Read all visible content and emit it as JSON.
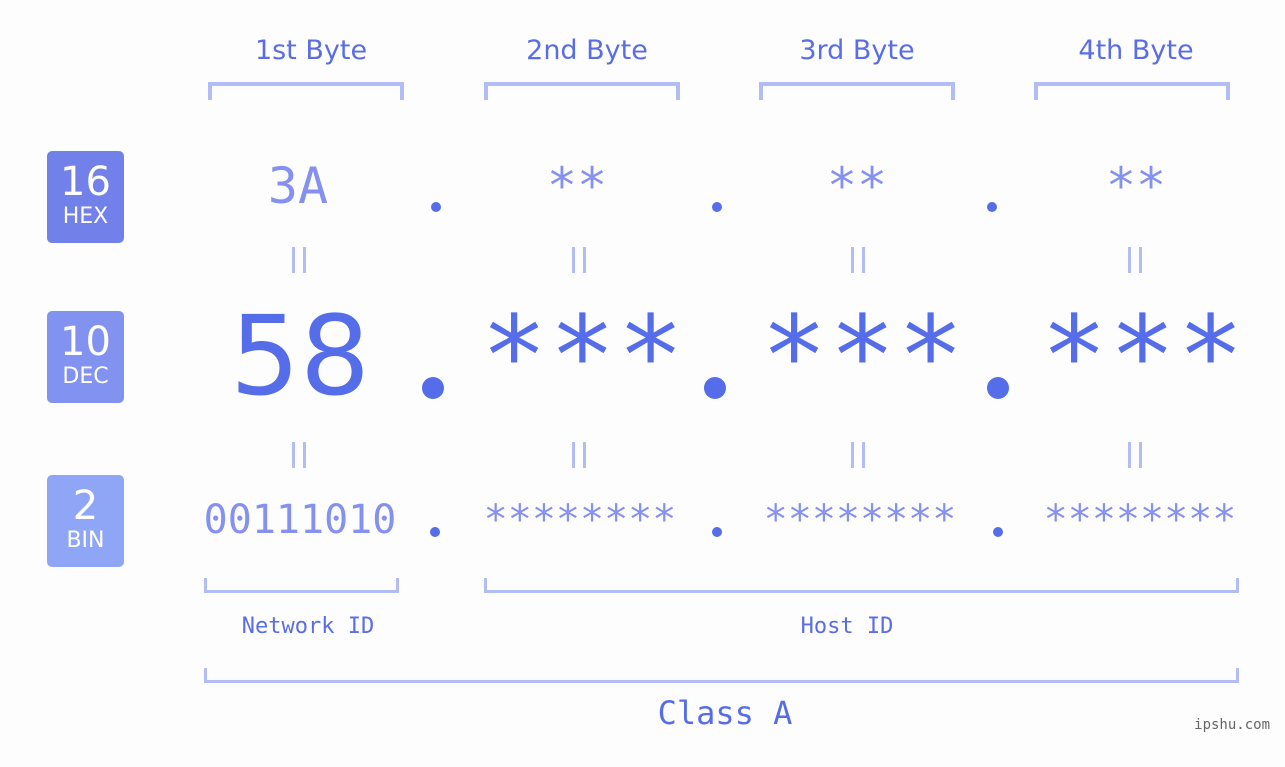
{
  "bases": [
    {
      "number": "16",
      "label": "HEX"
    },
    {
      "number": "10",
      "label": "DEC"
    },
    {
      "number": "2",
      "label": "BIN"
    }
  ],
  "byte_headers": [
    "1st Byte",
    "2nd Byte",
    "3rd Byte",
    "4th Byte"
  ],
  "hex": [
    "3A",
    "**",
    "**",
    "**"
  ],
  "dec": [
    "58",
    "***",
    "***",
    "***"
  ],
  "bin": [
    "00111010",
    "********",
    "********",
    "********"
  ],
  "network_label": "Network ID",
  "host_label": "Host ID",
  "class_label": "Class A",
  "watermark": "ipshu.com",
  "colors": {
    "accent": "#566de9",
    "hex_badge": "#7281ea",
    "dec_badge": "#8192f0",
    "bin_badge": "#8fa6f6",
    "bracket": "#b2bdf6"
  }
}
